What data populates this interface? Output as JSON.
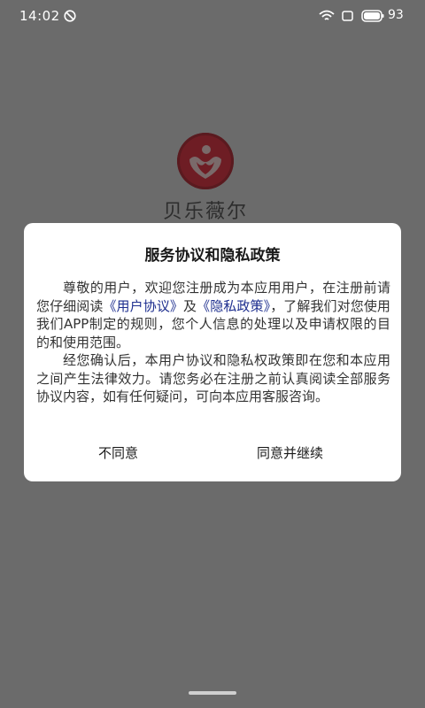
{
  "status_bar": {
    "time": "14:02",
    "battery_level": "93",
    "icons": [
      "do-not-disturb-icon",
      "wifi-icon",
      "sim-icon",
      "battery-icon"
    ]
  },
  "app": {
    "name": "贝乐薇尔",
    "logo_icon": "heart-logo-icon",
    "brand_color": "#9c1c24"
  },
  "dialog": {
    "title": "服务协议和隐私政策",
    "paragraph1": {
      "before_links": "尊敬的用户，欢迎您注册成为本应用用户，在注册前请您仔细阅读",
      "user_agreement_link": "《用户协议》",
      "conjunction": "及",
      "privacy_policy_link": "《隐私政策》",
      "after_links": "，了解我们对您使用我们APP制定的规则，您个人信息的处理以及申请权限的目的和使用范围。"
    },
    "paragraph2": "经您确认后，本用户协议和隐私权政策即在您和本应用之间产生法律效力。请您务必在注册之前认真阅读全部服务协议内容，如有任何疑问，可向本应用客服咨询。",
    "disagree_button": "不同意",
    "agree_button": "同意并继续",
    "link_color": "#1e2f8f"
  }
}
